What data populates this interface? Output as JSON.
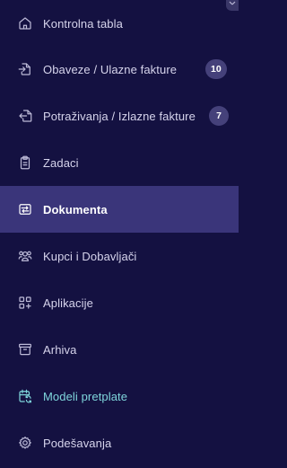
{
  "sidebar": {
    "items": [
      {
        "label": "Kontrolna tabla",
        "icon": "home-icon"
      },
      {
        "label": "Obaveze / Ulazne fakture",
        "icon": "file-import-icon",
        "badge": "10"
      },
      {
        "label": "Potraživanja / Izlazne fakture",
        "icon": "file-export-icon",
        "badge": "7"
      },
      {
        "label": "Zadaci",
        "icon": "clipboard-icon"
      },
      {
        "label": "Dokumenta",
        "icon": "documents-transfer-icon",
        "active": true
      },
      {
        "label": "Kupci i Dobavljači",
        "icon": "users-icon"
      },
      {
        "label": "Aplikacije",
        "icon": "apps-plus-icon"
      },
      {
        "label": "Arhiva",
        "icon": "archive-icon"
      },
      {
        "label": "Modeli pretplate",
        "icon": "calendar-repeat-icon",
        "highlight": true
      },
      {
        "label": "Podešavanja",
        "icon": "gear-icon"
      }
    ]
  },
  "colors": {
    "background": "#141141",
    "active_background": "#3a357a",
    "badge_background": "#45417a",
    "text": "#d6d4ec",
    "highlight_text": "#7fd6dc"
  }
}
